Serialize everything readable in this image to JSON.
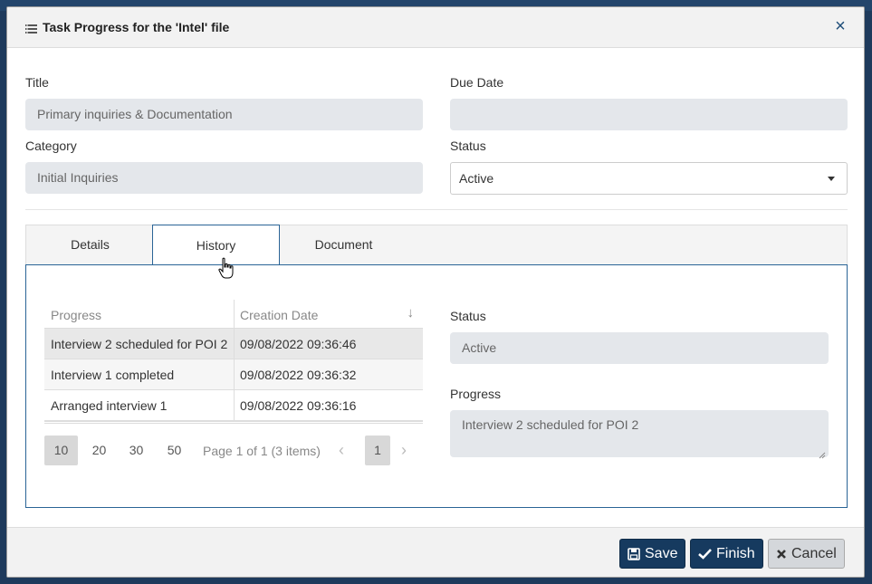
{
  "modal": {
    "title": "Task Progress for the 'Intel' file",
    "close_glyph": "×"
  },
  "form": {
    "title_label": "Title",
    "title_value": "Primary inquiries & Documentation",
    "due_date_label": "Due Date",
    "due_date_value": "",
    "category_label": "Category",
    "category_value": "Initial Inquiries",
    "status_label": "Status",
    "status_value": "Active"
  },
  "tabs": [
    {
      "label": "Details"
    },
    {
      "label": "History"
    },
    {
      "label": "Document"
    }
  ],
  "history": {
    "columns": [
      "Progress",
      "Creation Date"
    ],
    "sort_glyph": "↓",
    "rows": [
      {
        "progress": "Interview 2 scheduled for POI 2",
        "date": "09/08/2022 09:36:46"
      },
      {
        "progress": "Interview 1 completed",
        "date": "09/08/2022 09:36:32"
      },
      {
        "progress": "Arranged interview 1",
        "date": "09/08/2022 09:36:16"
      }
    ],
    "page_sizes": [
      "10",
      "20",
      "30",
      "50"
    ],
    "page_info": "Page 1 of 1 (3 items)",
    "current_page": "1",
    "prev_glyph": "‹",
    "next_glyph": "›"
  },
  "detail": {
    "status_label": "Status",
    "status_value": "Active",
    "progress_label": "Progress",
    "progress_value": "Interview 2 scheduled for POI 2"
  },
  "footer": {
    "save_label": "Save",
    "finish_label": "Finish",
    "cancel_label": "Cancel"
  },
  "colors": {
    "primary_button": "#163a5f",
    "active_tab_border": "#2a6496",
    "readonly_field": "#e4e7eb"
  }
}
